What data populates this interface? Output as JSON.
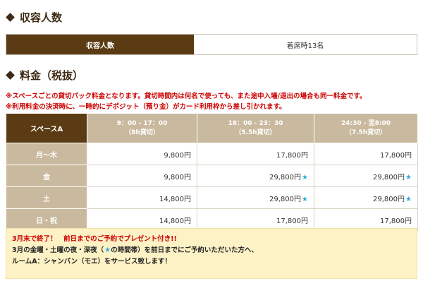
{
  "capacity": {
    "heading": "収容人数",
    "label": "収容人数",
    "value": "着席時13名"
  },
  "fee": {
    "heading": "料金（税抜）",
    "notes": [
      "※スペースごとの貸切パック料金となります。貸切時間内は何名で使っても、また途中入場/退出の場合も同一料金です。",
      "※利用料金の決済時に、一時的にデポジット（預り金）がカード利用枠から差し引かれます。"
    ],
    "table": {
      "space_label": "スペースA",
      "columns": [
        {
          "time": "9：00 - 17：00",
          "duration": "（8h貸切）"
        },
        {
          "time": "18：00 - 23：30",
          "duration": "（5.5h貸切）"
        },
        {
          "time": "24:30 - 翌8:00",
          "duration": "（7.5h貸切）"
        }
      ],
      "rows": [
        {
          "day": "月〜木",
          "prices": [
            "9,800円",
            "17,800円",
            "17,800円"
          ],
          "stars": [
            false,
            false,
            false
          ]
        },
        {
          "day": "金",
          "prices": [
            "9,800円",
            "29,800円",
            "29,800円"
          ],
          "stars": [
            false,
            true,
            true
          ]
        },
        {
          "day": "土",
          "prices": [
            "14,800円",
            "29,800円",
            "29,800円"
          ],
          "stars": [
            false,
            true,
            true
          ]
        },
        {
          "day": "日・祝",
          "prices": [
            "14,800円",
            "17,800円",
            "17,800円"
          ],
          "stars": [
            false,
            false,
            false
          ]
        }
      ],
      "star_symbol": "★"
    }
  },
  "notice": {
    "title": "3月末で終了！　前日までのご予約でプレゼント付き!!",
    "line2_before": "3月の金曜・土曜の夜・深夜（",
    "line2_star": "★",
    "line2_after": "の時間帯）を前日までにご予約いただいた方へ、",
    "line3": "ルームA：シャンパン（モエ）をサービス致します！"
  },
  "colors": {
    "brand_dark": "#5a3b14",
    "header_tan": "#c9b99e",
    "note_red": "#cc0000",
    "star_blue": "#33aadd",
    "notice_bg": "#fdf2c6"
  }
}
